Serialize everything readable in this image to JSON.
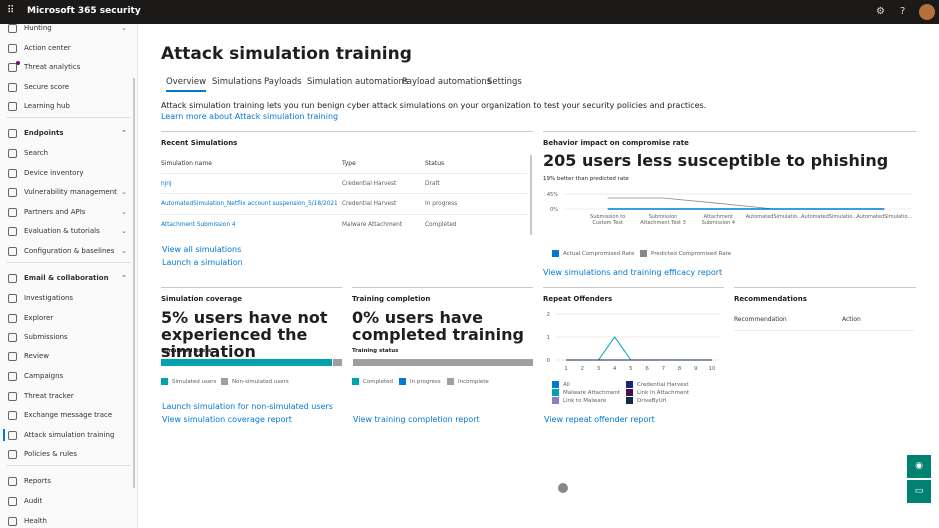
{
  "app": {
    "title": "Microsoft 365 security"
  },
  "sidebar": {
    "items": [
      {
        "label": "Hunting",
        "chev": "⌄"
      },
      {
        "label": "Action center"
      },
      {
        "label": "Threat analytics"
      },
      {
        "label": "Secure score"
      },
      {
        "label": "Learning hub"
      },
      {
        "label": "Endpoints",
        "header": true,
        "chev": "⌃"
      },
      {
        "label": "Search"
      },
      {
        "label": "Device inventory"
      },
      {
        "label": "Vulnerability management",
        "chev": "⌄"
      },
      {
        "label": "Partners and APIs",
        "chev": "⌄"
      },
      {
        "label": "Evaluation & tutorials",
        "chev": "⌄"
      },
      {
        "label": "Configuration & baselines",
        "chev": "⌄"
      },
      {
        "label": "Email & collaboration",
        "header": true,
        "chev": "⌃"
      },
      {
        "label": "Investigations"
      },
      {
        "label": "Explorer"
      },
      {
        "label": "Submissions"
      },
      {
        "label": "Review"
      },
      {
        "label": "Campaigns"
      },
      {
        "label": "Threat tracker"
      },
      {
        "label": "Exchange message trace"
      },
      {
        "label": "Attack simulation training",
        "active": true
      },
      {
        "label": "Policies & rules"
      },
      {
        "label": "Reports"
      },
      {
        "label": "Audit"
      },
      {
        "label": "Health"
      }
    ]
  },
  "page": {
    "title": "Attack simulation training",
    "tabs": [
      "Overview",
      "Simulations",
      "Payloads",
      "Simulation automations",
      "Payload automations",
      "Settings"
    ],
    "description": "Attack simulation training lets you run benign cyber attack simulations on your organization to test your security policies and practices.",
    "learn_more": "Learn more about Attack simulation training"
  },
  "recent": {
    "title": "Recent Simulations",
    "headers": [
      "Simulation name",
      "Type",
      "Status"
    ],
    "rows": [
      [
        "njnj",
        "Credential Harvest",
        "Draft"
      ],
      [
        "AutomatedSimulation_Netflix account suspension_5/18/2021",
        "Credential Harvest",
        "In progress"
      ],
      [
        "Attachment Submission 4",
        "Malware Attachment",
        "Completed"
      ]
    ],
    "view_all": "View all simulations",
    "launch": "Launch a simulation"
  },
  "behavior": {
    "title": "Behavior impact on compromise rate",
    "headline": "205 users less susceptible to phishing",
    "sub": "19% better than predicted rate",
    "link": "View simulations and training efficacy report"
  },
  "coverage": {
    "title": "Simulation coverage",
    "headline": "5% users have not experienced the simulation",
    "bar_label": "Simulated users",
    "simulated_pct": 95,
    "legend": [
      "Simulated users",
      "Non-simulated users"
    ],
    "link1": "Launch simulation for non-simulated users",
    "link2": "View simulation coverage report"
  },
  "training": {
    "title": "Training completion",
    "headline": "0% users have completed training",
    "bar_label": "Training status",
    "completed_pct": 0,
    "in_progress_pct": 0,
    "incomplete_pct": 100,
    "legend": [
      "Completed",
      "In progress",
      "Incomplete"
    ],
    "link": "View training completion report"
  },
  "repeat": {
    "title": "Repeat Offenders",
    "link": "View repeat offender report"
  },
  "recommendations": {
    "title": "Recommendations",
    "headers": [
      "Recommendation",
      "Action"
    ]
  },
  "colors": {
    "accent": "#0078d4",
    "teal": "#00a2ad",
    "gray": "#a19f9d"
  },
  "chart_data": [
    {
      "type": "line",
      "title": "Behavior impact on compromise rate",
      "categories": [
        "Submission to Custom Test",
        "Submission Attachment Test 3",
        "Attachment Submission 4",
        "AutomatedSimulatio...",
        "AutomatedSimulatio...",
        "AutomatedSimulatio..."
      ],
      "yticks": [
        "45%",
        "0%"
      ],
      "ylim": [
        0,
        45
      ],
      "series": [
        {
          "name": "Actual Compromised Rate",
          "color": "#0078d4",
          "values": [
            0,
            0,
            0,
            0,
            0,
            0
          ]
        },
        {
          "name": "Predicted Compromised Rate",
          "color": "#8a8886",
          "values": [
            33,
            33,
            17,
            0,
            0,
            0
          ]
        }
      ]
    },
    {
      "type": "line",
      "title": "Repeat Offenders",
      "x": [
        1,
        2,
        3,
        4,
        5,
        6,
        7,
        8,
        9,
        10
      ],
      "ylim": [
        0,
        2
      ],
      "yticks": [
        2,
        1,
        0
      ],
      "series": [
        {
          "name": "All",
          "color": "#0078d4",
          "values": [
            0,
            0,
            0,
            0,
            0,
            0,
            0,
            0,
            0,
            0
          ]
        },
        {
          "name": "Credential Harvest",
          "color": "#1a237e",
          "values": [
            0,
            0,
            0,
            0,
            0,
            0,
            0,
            0,
            0,
            0
          ]
        },
        {
          "name": "Malware Attachment",
          "color": "#00a2ad",
          "values": [
            0,
            0,
            0,
            1,
            0,
            0,
            0,
            0,
            0,
            0
          ]
        },
        {
          "name": "Link in Attachment",
          "color": "#4a0e4e",
          "values": [
            0,
            0,
            0,
            0,
            0,
            0,
            0,
            0,
            0,
            0
          ]
        },
        {
          "name": "Link to Malware",
          "color": "#8e7cc3",
          "values": [
            0,
            0,
            0,
            0,
            0,
            0,
            0,
            0,
            0,
            0
          ]
        },
        {
          "name": "DriveByUrl",
          "color": "#102a43",
          "values": [
            0,
            0,
            0,
            0,
            0,
            0,
            0,
            0,
            0,
            0
          ]
        }
      ]
    }
  ]
}
